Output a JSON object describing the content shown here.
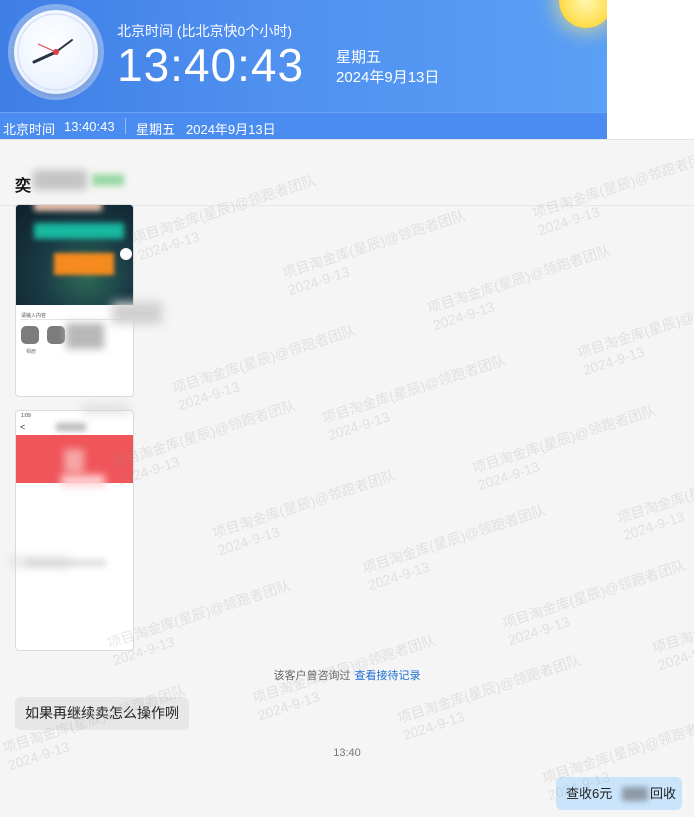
{
  "clock": {
    "caption": "北京时间 (比北京快0个小时)",
    "hours": "13",
    "minutes": "40",
    "seconds": "43",
    "weekday": "星期五",
    "date": "2024年9月13日",
    "colors": {
      "panel": "#4f90f0",
      "strip": "#4a8cf0",
      "sun": "#ffe25c"
    },
    "icons": {
      "clock": "analog-clock-icon",
      "sun": "sun-icon"
    }
  },
  "status_strip": {
    "label": "北京时间",
    "time": "13:40:43",
    "weekday": "星期五",
    "date": "2024年9月13日"
  },
  "chat": {
    "name_char": "奕",
    "image_messages": [
      {
        "caption": "请输入内容",
        "icon_caption": "相册"
      },
      {
        "status": "1:09",
        "back": "<"
      }
    ],
    "notice": {
      "prefix": "该客户曾咨询过",
      "link": "查看接待记录"
    },
    "left_message": "如果再继续卖怎么操作咧",
    "timestamp": "13:40",
    "right_message": {
      "part1": "查收6元",
      "part2": "回收"
    },
    "colors": {
      "link": "#1f6fd6",
      "right_bubble": "#c9e4fb",
      "left_bubble": "#e7e7e7"
    }
  },
  "watermark": {
    "line1": "项目淘金库(星辰)@领跑者团队",
    "line2": "2024-9-13"
  }
}
